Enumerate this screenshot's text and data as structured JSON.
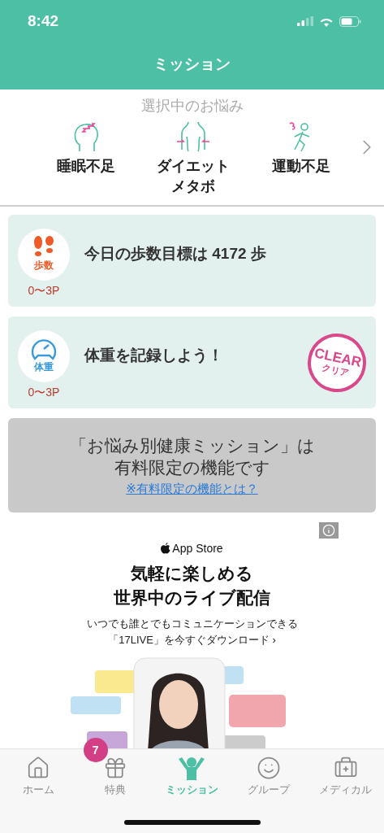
{
  "status_bar": {
    "time": "8:42"
  },
  "header": {
    "title": "ミッション"
  },
  "concerns": {
    "heading": "選択中のお悩み",
    "items": [
      {
        "kind": "sleep",
        "lines": [
          "睡眠不足"
        ]
      },
      {
        "kind": "diet",
        "lines": [
          "ダイエット",
          "メタボ"
        ]
      },
      {
        "kind": "exercise",
        "lines": [
          "運動不足"
        ]
      }
    ]
  },
  "missions": [
    {
      "kind": "steps",
      "badge": "歩数",
      "points": "0〜3P",
      "title": "今日の歩数目標は 4172 歩"
    },
    {
      "kind": "weight",
      "badge": "体重",
      "points": "0〜3P",
      "title": "体重を記録しよう！",
      "stamp": {
        "label": "CLEAR",
        "sublabel": "クリア"
      }
    }
  ],
  "locked": {
    "message": [
      "「お悩み別健康ミッション」は",
      "有料限定の機能です"
    ],
    "link": "※有料限定の機能とは？"
  },
  "ad": {
    "store": "App Store",
    "headline": [
      "気軽に楽しめる",
      "世界中のライブ配信"
    ],
    "body": [
      "いつでも誰とでもコミュニケーションできる",
      "「17LIVE」を今すぐダウンロード ›"
    ]
  },
  "tabs": [
    {
      "kind": "home",
      "label": "ホーム",
      "selected": false
    },
    {
      "kind": "gift",
      "label": "特典",
      "selected": false,
      "badge": "7"
    },
    {
      "kind": "mission",
      "label": "ミッション",
      "selected": true
    },
    {
      "kind": "group",
      "label": "グループ",
      "selected": false
    },
    {
      "kind": "medical",
      "label": "メディカル",
      "selected": false
    }
  ]
}
